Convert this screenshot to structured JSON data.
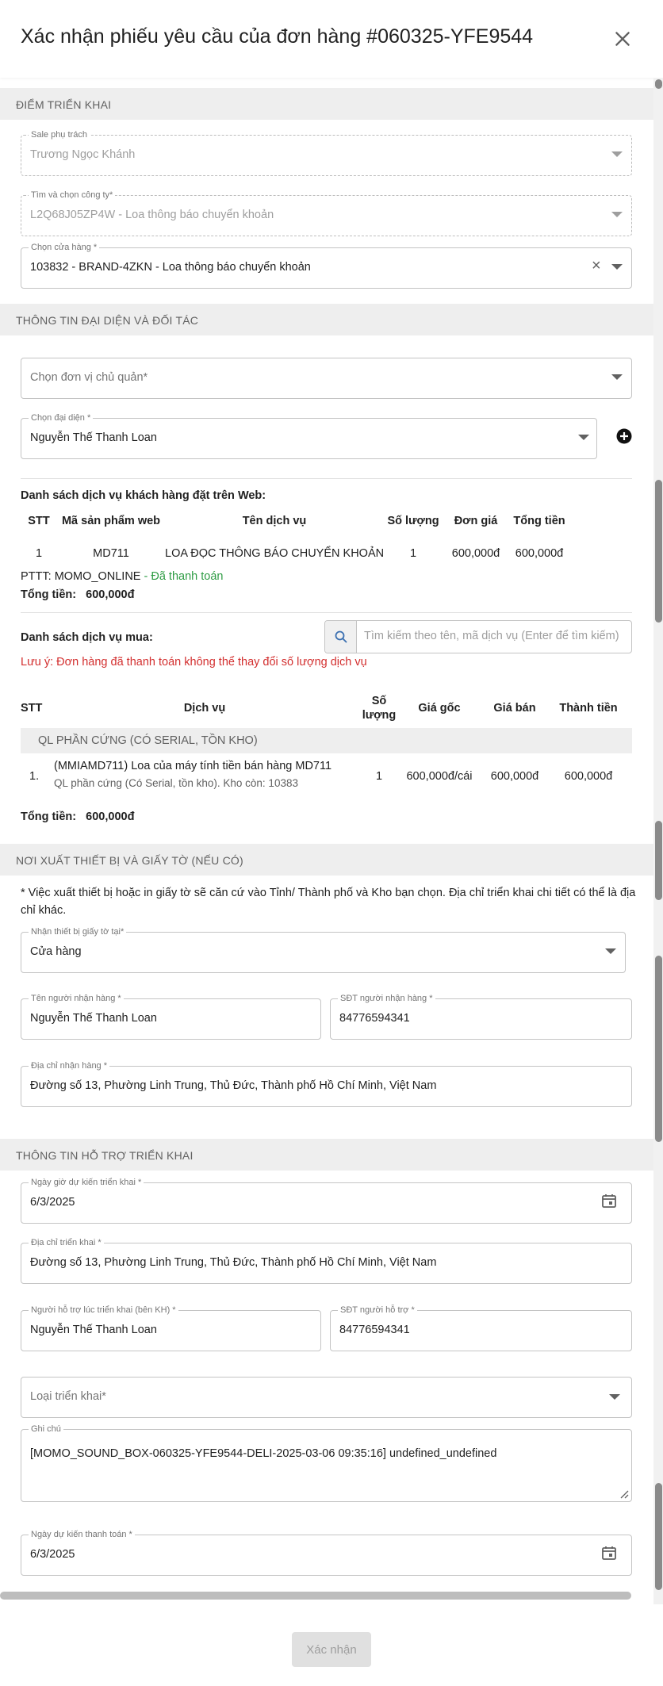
{
  "header": {
    "title": "Xác nhận phiếu yêu cầu của đơn hàng #060325-YFE9544"
  },
  "deploy_point": {
    "section_title": "ĐIỂM TRIỂN KHAI",
    "sale": {
      "label": "Sale phụ trách",
      "value": "Trương Ngọc Khánh"
    },
    "company": {
      "label": "Tìm và chọn công ty*",
      "value": "L2Q68J05ZP4W - Loa thông báo chuyển khoản"
    },
    "store": {
      "label": "Chọn cửa hàng *",
      "value": "103832 - BRAND-4ZKN - Loa thông báo chuyển khoản",
      "clear": "×"
    }
  },
  "partner": {
    "section_title": "THÔNG TIN ĐẠI DIỆN VÀ ĐỐI TÁC",
    "owner_unit_placeholder": "Chọn đơn vị chủ quản*",
    "representative": {
      "label": "Chọn đại diện *",
      "value": "Nguyễn Thế Thanh Loan"
    }
  },
  "web_services": {
    "title": "Danh sách dịch vụ khách hàng đặt trên Web:",
    "columns": [
      "STT",
      "Mã sản phẩm web",
      "Tên dịch vụ",
      "Số lượng",
      "Đơn giá",
      "Tổng tiền"
    ],
    "rows": [
      {
        "stt": "1",
        "code": "MD711",
        "name": "LOA ĐỌC THÔNG BÁO CHUYỂN KHOẢN",
        "qty": "1",
        "price": "600,000đ",
        "total": "600,000đ"
      }
    ],
    "payment_prefix": "PTTT: MOMO_ONLINE",
    "payment_status": "- Đã thanh toán",
    "total_label": "Tổng tiền:",
    "total_value": "600,000đ"
  },
  "purchase": {
    "title": "Danh sách dịch vụ mua:",
    "search_placeholder": "Tìm kiếm theo tên, mã dịch vụ (Enter để tìm kiếm)",
    "note": "Lưu ý: Đơn hàng đã thanh toán không thể thay đổi số lượng dịch vụ",
    "columns": {
      "stt": "STT",
      "service": "Dịch vụ",
      "qty_line1": "Số",
      "qty_line2": "lượng",
      "orig_price": "Giá gốc",
      "sale_price": "Giá bán",
      "amount": "Thành tiền"
    },
    "group_name": "QL PHẦN CỨNG (CÓ SERIAL, TỒN KHO)",
    "rows": [
      {
        "stt": "1.",
        "name": "(MMIAMD711) Loa của máy tính tiền bán hàng MD711",
        "sub": "QL phần cứng (Có Serial, tồn kho). Kho còn: 10383",
        "qty": "1",
        "orig_price": "600,000đ/cái",
        "sale_price": "600,000đ",
        "amount": "600,000đ"
      }
    ],
    "total_label": "Tổng tiền:",
    "total_value": "600,000đ"
  },
  "delivery": {
    "section_title": "NƠI XUẤT THIẾT BỊ VÀ GIẤY TỜ (NẾU CÓ)",
    "info_line1": "* Việc xuất thiết bị hoặc in giấy tờ sẽ căn cứ vào Tỉnh/ Thành phố và Kho bạn chọn. Địa chỉ triển khai chi tiết có thể là địa",
    "info_line2": "chỉ khác.",
    "receive_at": {
      "label": "Nhận thiết bị giấy tờ tại*",
      "value": "Cửa hàng"
    },
    "receiver_name": {
      "label": "Tên người nhận hàng *",
      "value": "Nguyễn Thế Thanh Loan"
    },
    "receiver_phone": {
      "label": "SĐT người nhận hàng *",
      "value": "84776594341"
    },
    "address": {
      "label": "Địa chỉ nhận hàng *",
      "value": "Đường số 13, Phường Linh Trung, Thủ Đức, Thành phố Hồ Chí Minh, Việt Nam"
    }
  },
  "support": {
    "section_title": "THÔNG TIN HỖ TRỢ TRIỂN KHAI",
    "deploy_date": {
      "label": "Ngày giờ dự kiến triển khai *",
      "value": "6/3/2025"
    },
    "deploy_address": {
      "label": "Địa chỉ triển khai *",
      "value": "Đường số 13, Phường Linh Trung, Thủ Đức, Thành phố Hồ Chí Minh, Việt Nam"
    },
    "support_person": {
      "label": "Người hỗ trợ lúc triển khai (bên KH) *",
      "value": "Nguyễn Thế Thanh Loan"
    },
    "support_phone": {
      "label": "SĐT người hỗ trợ *",
      "value": "84776594341"
    },
    "deploy_type_placeholder": "Loại triển khai*",
    "note": {
      "label": "Ghi chú",
      "value": "[MOMO_SOUND_BOX-060325-YFE9544-DELI-2025-03-06 09:35:16] undefined_undefined"
    },
    "payment_date": {
      "label": "Ngày dự kiến thanh toán *",
      "value": "6/3/2025"
    }
  },
  "footer": {
    "confirm_label": "Xác nhận"
  },
  "colors": {
    "success": "#2e9c44",
    "danger": "#d32f2f",
    "section_bg": "#eeeeee",
    "disabled_btn": "#e0e0e0"
  }
}
